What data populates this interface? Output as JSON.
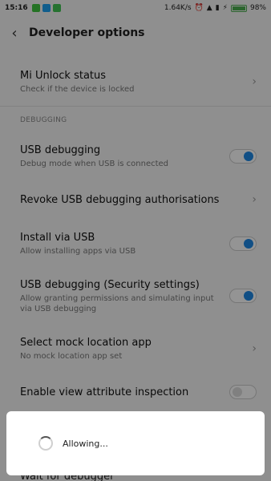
{
  "status_bar": {
    "time": "15:16",
    "speed": "1.64K/s",
    "battery": "98%",
    "battery_level": 0.98,
    "app_icons": [
      "green-app-icon",
      "skype-icon",
      "whatsapp-icon"
    ],
    "status_icons": [
      "alarm-icon",
      "wifi-icon",
      "signal-icon",
      "charging-icon",
      "battery-icon"
    ]
  },
  "header": {
    "title": "Developer options",
    "back_icon": "chevron-left-icon"
  },
  "items": {
    "mi_unlock": {
      "title": "Mi Unlock status",
      "subtitle": "Check if the device is locked"
    },
    "section_debugging": "DEBUGGING",
    "usb_debugging": {
      "title": "USB debugging",
      "subtitle": "Debug mode when USB is connected",
      "enabled": true
    },
    "revoke": {
      "title": "Revoke USB debugging authorisations"
    },
    "install_usb": {
      "title": "Install via USB",
      "subtitle": "Allow installing apps via USB",
      "enabled": true
    },
    "usb_security": {
      "title": "USB debugging (Security settings)",
      "subtitle_line1": "Allow granting permissions and simulating input",
      "subtitle_line2": "via USB debugging",
      "enabled": true
    },
    "mock_location": {
      "title": "Select mock location app",
      "subtitle": "No mock location app set"
    },
    "view_attr": {
      "title": "Enable view attribute inspection",
      "enabled": false
    },
    "wait_debugger": {
      "title": "Wait for debugger"
    }
  },
  "dialog": {
    "message": "Allowing..."
  },
  "colors": {
    "accent": "#1e88e5",
    "battery": "#4caf50"
  }
}
